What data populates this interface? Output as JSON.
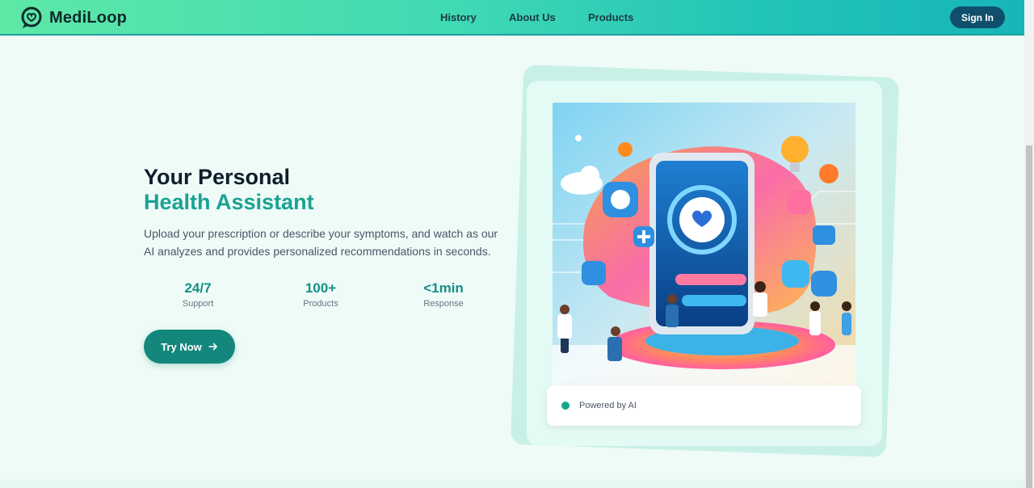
{
  "header": {
    "brand": "MediLoop",
    "nav": [
      "History",
      "About Us",
      "Products"
    ],
    "signin_label": "Sign In"
  },
  "hero": {
    "title_line1": "Your Personal",
    "title_line2": "Health Assistant",
    "description": "Upload your prescription or describe your symptoms, and watch as our AI analyzes and provides personalized recommendations in seconds.",
    "stats": [
      {
        "value": "24/7",
        "label": "Support"
      },
      {
        "value": "100+",
        "label": "Products"
      },
      {
        "value": "<1min",
        "label": "Response"
      }
    ],
    "cta_label": "Try Now",
    "cta_icon": "arrow-right-icon"
  },
  "card": {
    "badge_text": "Powered by AI",
    "badge_color": "#14a58e"
  },
  "colors": {
    "accent": "#1aa293",
    "primary_button": "#14877c",
    "signin_button": "#0f4f6b"
  }
}
